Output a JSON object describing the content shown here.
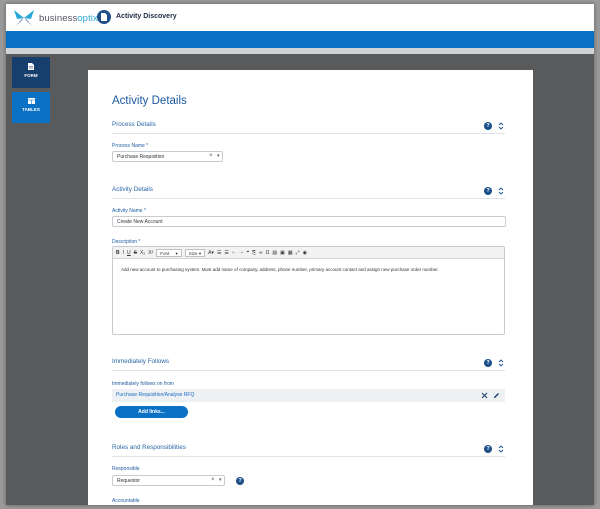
{
  "app": {
    "logo_prefix": "business",
    "logo_suffix": "optix",
    "title": "Activity Discovery"
  },
  "sidebar": {
    "items": [
      {
        "label": "FORM",
        "icon": "document-icon",
        "active": true
      },
      {
        "label": "TABLES",
        "icon": "table-icon",
        "active": false
      }
    ]
  },
  "form": {
    "heading": "Activity Details",
    "process_section": {
      "title": "Process Details",
      "process_name_label": "Process Name *",
      "process_name_value": "Purchase Requisition"
    },
    "activity_section": {
      "title": "Activity Details",
      "activity_name_label": "Activity Name *",
      "activity_name_value": "Create New Account",
      "description_label": "Description *",
      "toolbar": {
        "bold": "B",
        "italic": "I",
        "underline": "U",
        "strike": "S",
        "subscript": "X₂",
        "superscript": "X²",
        "font": "Font",
        "size": "Size"
      },
      "description_value": "Add new account to purchasing system.  Must add name of company, address, phone number, primary account contact and assign new purchase order number."
    },
    "follows_section": {
      "title": "Immediately Follows",
      "follows_label": "Immediately follows on from",
      "links": [
        "Purchase Requisition/Analyse RFQ"
      ],
      "add_links_label": "Add links..."
    },
    "roles_section": {
      "title": "Roles and Responsibilities",
      "responsible_label": "Responsible",
      "responsible_value": "Requestor",
      "accountable_label": "Accountable"
    }
  },
  "colors": {
    "primary_blue": "#0b71c5",
    "navy": "#173f6d",
    "heading_blue": "#1a5a9e",
    "frame_gray": "#595a5c"
  }
}
